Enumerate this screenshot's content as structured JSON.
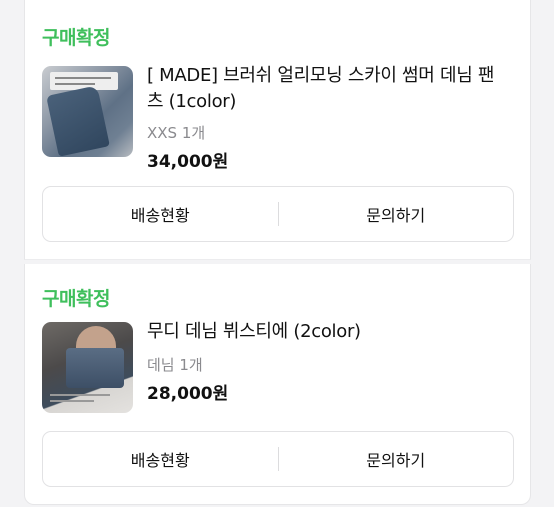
{
  "orders": [
    {
      "status": "구매확정",
      "title": "[ MADE] 브러쉬 얼리모닝 스카이 썸머 데님 팬츠 (1color)",
      "option": "XXS 1개",
      "price": "34,000원",
      "thumbnail_icon": "denim-pants-photo",
      "actions": {
        "shipping": "배송현황",
        "inquiry": "문의하기"
      }
    },
    {
      "status": "구매확정",
      "title": "무디 데님 뷔스티에 (2color)",
      "option": "데님 1개",
      "price": "28,000원",
      "thumbnail_icon": "denim-bustier-photo",
      "actions": {
        "shipping": "배송현황",
        "inquiry": "문의하기"
      }
    }
  ],
  "colors": {
    "status_green": "#3fbf5c",
    "option_gray": "#8a8a8e",
    "border": "#e2e2e4"
  }
}
